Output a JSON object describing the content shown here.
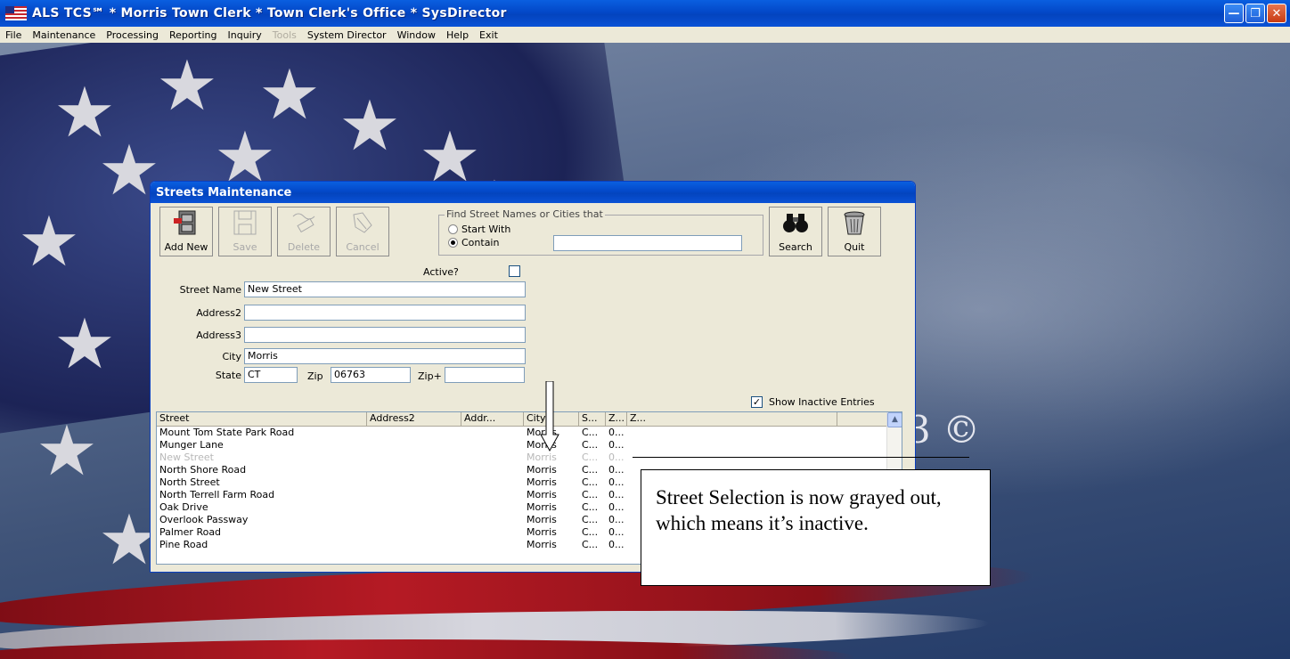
{
  "app": {
    "title": "ALS TCS℠ * Morris Town Clerk * Town Clerk's Office * SysDirector",
    "window_buttons": [
      "minimize",
      "restore",
      "close"
    ]
  },
  "menu": [
    {
      "label": "File",
      "enabled": true
    },
    {
      "label": "Maintenance",
      "enabled": true
    },
    {
      "label": "Processing",
      "enabled": true
    },
    {
      "label": "Reporting",
      "enabled": true
    },
    {
      "label": "Inquiry",
      "enabled": true
    },
    {
      "label": "Tools",
      "enabled": false
    },
    {
      "label": "System Director",
      "enabled": true
    },
    {
      "label": "Window",
      "enabled": true
    },
    {
      "label": "Help",
      "enabled": true
    },
    {
      "label": "Exit",
      "enabled": true
    }
  ],
  "background_text": "3 ©",
  "dialog": {
    "title": "Streets Maintenance",
    "toolbar": {
      "add_new": "Add New",
      "save": "Save",
      "delete": "Delete",
      "cancel": "Cancel",
      "search": "Search",
      "quit": "Quit"
    },
    "find": {
      "legend": "Find Street Names or Cities that",
      "start_with": "Start With",
      "contain": "Contain",
      "selected": "Contain",
      "value": ""
    },
    "form": {
      "active_label": "Active?",
      "active_checked": false,
      "street_name_label": "Street Name",
      "street_name": "New Street",
      "address2_label": "Address2",
      "address2": "",
      "address3_label": "Address3",
      "address3": "",
      "city_label": "City",
      "city": "Morris",
      "state_label": "State",
      "state": "CT",
      "zip_label": "Zip",
      "zip": "06763",
      "zip_plus_label": "Zip+",
      "zip_plus": ""
    },
    "show_inactive": {
      "label": "Show Inactive Entries",
      "checked": true
    },
    "grid": {
      "columns": [
        "Street",
        "Address2",
        "Addr...",
        "City",
        "S...",
        "Z...",
        "Z..."
      ],
      "rows": [
        {
          "street": "Mount Tom State Park Road",
          "city": "Morris",
          "state": "C...",
          "zip": "0...",
          "inactive": false
        },
        {
          "street": "Munger Lane",
          "city": "Morris",
          "state": "C...",
          "zip": "0...",
          "inactive": false
        },
        {
          "street": "New Street",
          "city": "Morris",
          "state": "C...",
          "zip": "0...",
          "inactive": true
        },
        {
          "street": "North Shore Road",
          "city": "Morris",
          "state": "C...",
          "zip": "0...",
          "inactive": false
        },
        {
          "street": "North Street",
          "city": "Morris",
          "state": "C...",
          "zip": "0...",
          "inactive": false
        },
        {
          "street": "North Terrell Farm Road",
          "city": "Morris",
          "state": "C...",
          "zip": "0...",
          "inactive": false
        },
        {
          "street": "Oak Drive",
          "city": "Morris",
          "state": "C...",
          "zip": "0...",
          "inactive": false
        },
        {
          "street": "Overlook Passway",
          "city": "Morris",
          "state": "C...",
          "zip": "0...",
          "inactive": false
        },
        {
          "street": "Palmer Road",
          "city": "Morris",
          "state": "C...",
          "zip": "0...",
          "inactive": false
        },
        {
          "street": "Pine Road",
          "city": "Morris",
          "state": "C...",
          "zip": "0...",
          "inactive": false
        }
      ]
    }
  },
  "annotation": {
    "callout_text": "Street Selection is now grayed out, which means it’s inactive."
  }
}
